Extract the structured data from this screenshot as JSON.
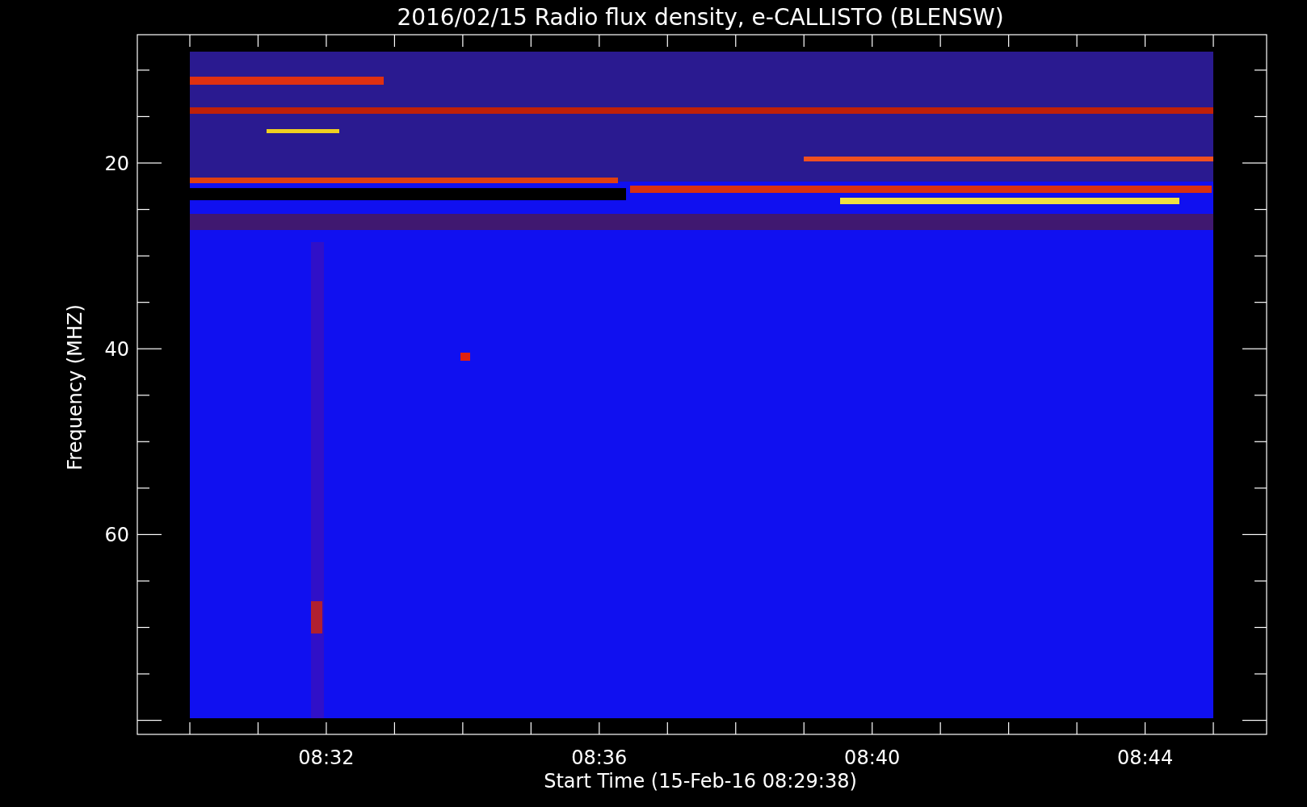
{
  "title": "2016/02/15  Radio flux density, e-CALLISTO (BLENSW)",
  "y_axis": {
    "label": "Frequency (MHZ)",
    "tick_labels": [
      "20",
      "40",
      "60"
    ]
  },
  "x_axis": {
    "label": "Start Time (15-Feb-16 08:29:38)",
    "tick_labels": [
      "08:32",
      "08:36",
      "08:40",
      "08:44"
    ]
  }
}
